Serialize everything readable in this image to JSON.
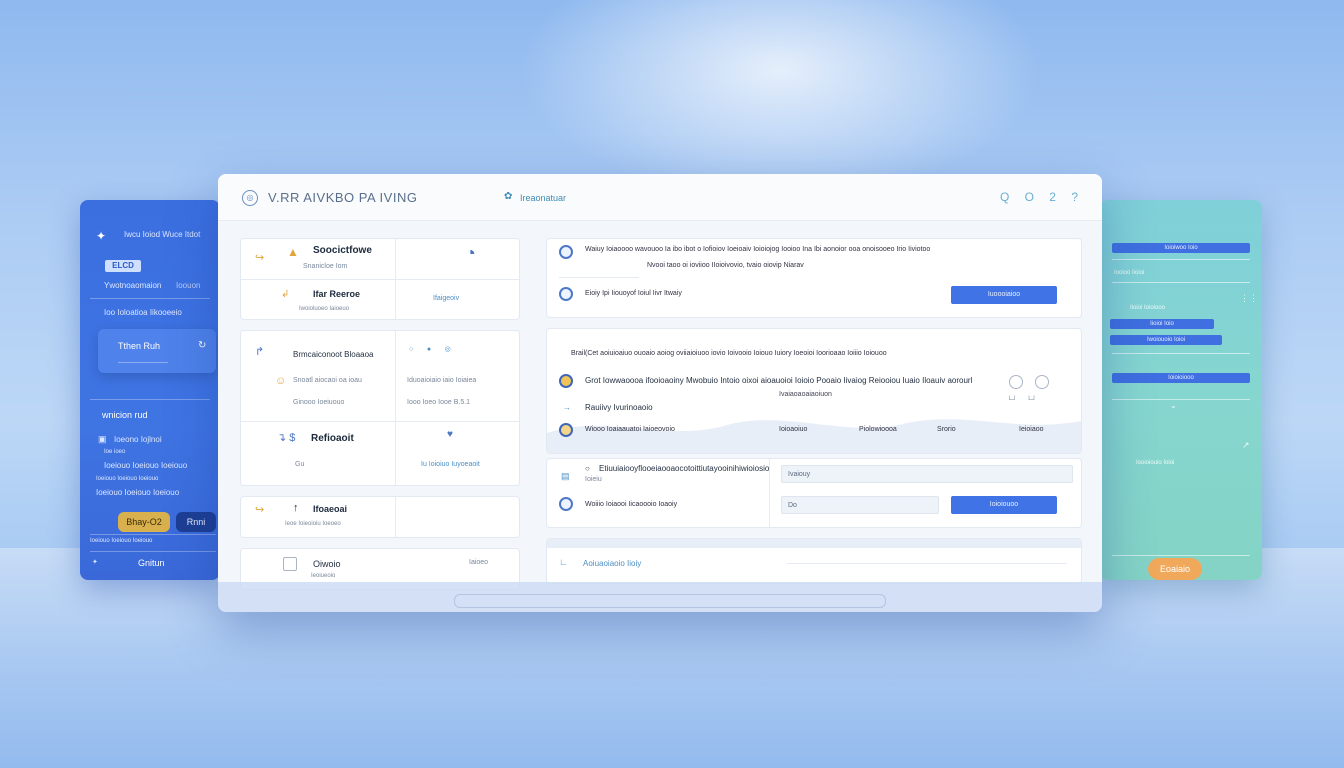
{
  "left_panel": {
    "header": "Iwcu Ioiod Wuce Itdot",
    "chip": "ELCD",
    "row1": "Ywotnoaomaion",
    "row1_right": "Ioouon",
    "row2": "Ioo Ioloatioa Iikooeeio",
    "card_title": "Tthen Ruh",
    "section": "wnicion rud",
    "row3": "Ioeono Iojlnoi",
    "row4": "Ioe ioeo",
    "row5": "Ioeiouo Ioeiouo Ioeiouo",
    "row6": "Ioeiouo Ioeiouo Ioeiouo",
    "row7": "Ioeiouo Ioeiouo Ioeiouo",
    "gold_button": "Bhay-O2",
    "navy_button": "Rnni",
    "footer_row": "Ioeiouo Ioeiouo Ioeiouo",
    "footer_label": "Gnitun"
  },
  "window": {
    "title": "V.RR AIVKBO PA IVING",
    "breadcrumb": "Ireaonatuar",
    "tools": "Q O 2 ?",
    "left_col": {
      "r1_title": "Soocictfowe",
      "r1_sub": "Snanicloe Iom",
      "r2_title": "Ifar Reeroe",
      "r2_sub": "Iwoioluoeo Iaioeuo",
      "r2_right": "Ifaigeoiv",
      "g2_header": "Brmcaiconoot Bloaaoa",
      "g2_row1": "Snoatl aiocaoi oa ioau",
      "g2_row1_right": "Iduoaioiaio iaio Ioiaiea",
      "g2_row2": "Ginooo Ioeiuouo",
      "g2_row2_right": "Iooo Ioeo Iooe B.5.1",
      "g2_title": "Refioaoit",
      "g2_sub": "Gu",
      "g2_right": "Iu Ioioiuo Iuyoeaoit",
      "g3_title": "Ifoaeoai",
      "g3_sub": "Ieoe Ioieoioiu Ioeoeo",
      "g4_title": "Oiwoio",
      "g4_sub": "Ieoiueoio",
      "g4_right": "Iaioeo"
    },
    "top_panel": {
      "line1": "Waiuy Ioiaoooo wavouoo Ia ibo ibot o Iofioiov Ioeioaiv Ioioiojog Iooioo Ina Ibi aonoior ooa onoisooeo Irio Iiviotoo",
      "line2": "Nvooi taoo oi ioviioo IIoioivovio, tvaio oiovip Niarav",
      "row_label": "Eioiy Ipi Iiouoyof Ioiul Iivr Itwaiy",
      "button": "Iuoooiaioo"
    },
    "mid_panel": {
      "line1": "Brail(Cet aoiuioaiuo ouoaio aoiog oviiaioiuoo iovio Ioivooio Ioiouo Iuiory Ioeoioi Ioorioaao Ioiiio Ioiouoo",
      "line2": "Grot Iowwaoooa ifooioaoiny Mwobuio Intoio oixoi aioauoioi Ioioio Pooaio Iivaiog Reiooiou Iuaio Iloauiv aorourl",
      "line3": "Ivaiaoaoaiaoiuon",
      "line4": "Rauiivy Ivurinoaoio",
      "row_a": "Wiooo Ioaiaauatoi Iaioeovoio",
      "col_b": "Ioioaoiuo",
      "col_c": "Piolowioooa",
      "col_d": "Srorio",
      "col_e": "Ieioiaoo"
    },
    "form_panel": {
      "title": "Etiuuiaiooyflooeiaooaocotoittiutayooinihiwioiosio",
      "sub": "Ioieiu",
      "row2": "Woiiio Ioiaooi Iicaoooio Ioaoiy",
      "input1_placeholder": "Ivaiouy",
      "input2_placeholder": "Do",
      "button": "Ioioiouoo"
    },
    "bottom_panel": {
      "label": "Aoiuaoiaoio Iioiy"
    }
  },
  "right_panel": {
    "bar1": "Ioioiwoo Ioio",
    "txt1": "Iooioo Iioioi",
    "txt2": "Iioioi Ioioiooo",
    "bar2": "Iioioi Ioio",
    "bar3": "Iwoiouoio Ioioi",
    "txt3": "Ioioioiooo",
    "txt4": "Iooioiouio Ioioi",
    "button": "Eoaiaio"
  },
  "colors": {
    "primary": "#3f73e6",
    "left_panel": "#3b6fe0",
    "right_panel": "#86d6cf",
    "accent_gold": "#d9b04e",
    "accent_orange": "#f0a95b"
  }
}
